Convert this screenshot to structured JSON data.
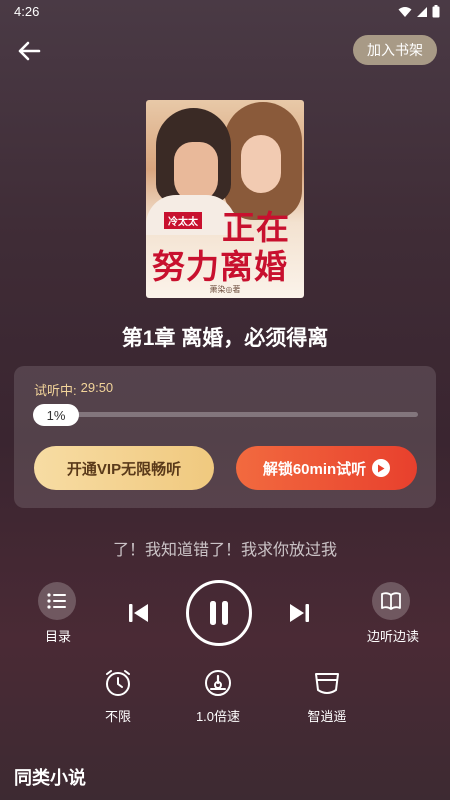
{
  "status_bar": {
    "time": "4:26"
  },
  "header": {
    "add_to_shelf_label": "加入书架"
  },
  "book": {
    "cover": {
      "tag": "冷太太",
      "title_line1": "正在",
      "title_line2": "努力离婚",
      "author": "萧染◎著"
    },
    "chapter_title": "第1章 离婚，必须得离"
  },
  "trial": {
    "label": "试听中:",
    "remaining": "29:50",
    "progress_text": "1%",
    "progress": 0.01,
    "vip_button_label": "开通VIP无限畅听",
    "unlock_button_label": "解锁60min试听"
  },
  "lyric_line": "了！我知道错了！我求你放过我",
  "controls": {
    "catalog_label": "目录",
    "read_while_listen_label": "边听边读"
  },
  "options": {
    "timer_label": "不限",
    "speed_label": "1.0倍速",
    "voice_label": "智逍遥"
  },
  "similar": {
    "title": "同类小说"
  },
  "colors": {
    "accent_gold": "#f2d49a",
    "unlock_red": "#e8402d",
    "cover_title_red": "#c8102e"
  }
}
